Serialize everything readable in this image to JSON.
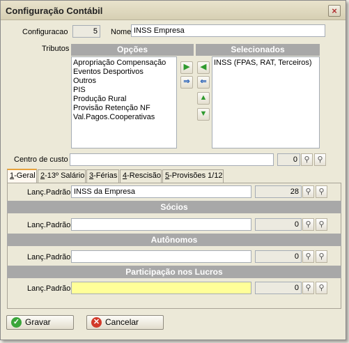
{
  "window": {
    "title": "Configuração Contábil",
    "close_label": "×"
  },
  "header": {
    "config_label": "Configuracao",
    "config_value": "5",
    "nome_label": "Nome",
    "nome_value": "INSS Empresa"
  },
  "tributos": {
    "label": "Tributos",
    "opcoes_header": "Opções",
    "selecionados_header": "Selecionados",
    "opcoes": [
      "Apropriação Compensação",
      "Eventos Desportivos",
      "Outros",
      "PIS",
      "Produção Rural",
      "Provisão Retenção NF",
      "Val.Pagos.Cooperativas"
    ],
    "selecionados": [
      "INSS (FPAS, RAT, Terceiros)"
    ]
  },
  "centro_custo": {
    "label": "Centro de custo",
    "value": "",
    "code": "0"
  },
  "tabs": [
    {
      "label": "1-Geral",
      "key": "1",
      "rest": "-Geral"
    },
    {
      "label": "2-13º Salário",
      "key": "2",
      "rest": "-13º Salário"
    },
    {
      "label": "3-Férias",
      "key": "3",
      "rest": "-Férias"
    },
    {
      "label": "4-Rescisão",
      "key": "4",
      "rest": "-Rescisão"
    },
    {
      "label": "5-Provisões 1/12",
      "key": "5",
      "rest": "-Provisões 1/12"
    }
  ],
  "geral": {
    "rows": [
      {
        "label": "Lanç.Padrão",
        "value": "INSS da Empresa",
        "code": "28"
      },
      {
        "label": "Lanç.Padrão",
        "value": "",
        "code": "0"
      },
      {
        "label": "Lanç.Padrão",
        "value": "",
        "code": "0"
      },
      {
        "label": "Lanç.Padrão",
        "value": "",
        "code": "0"
      }
    ],
    "sections": [
      "Sócios",
      "Autônomos",
      "Participação nos Lucros"
    ]
  },
  "buttons": {
    "save": "Gravar",
    "cancel": "Cancelar"
  },
  "colors": {
    "accent_tab": "#e6a23c",
    "highlight_field": "#ffff99",
    "section_header": "#a8a8a8"
  }
}
